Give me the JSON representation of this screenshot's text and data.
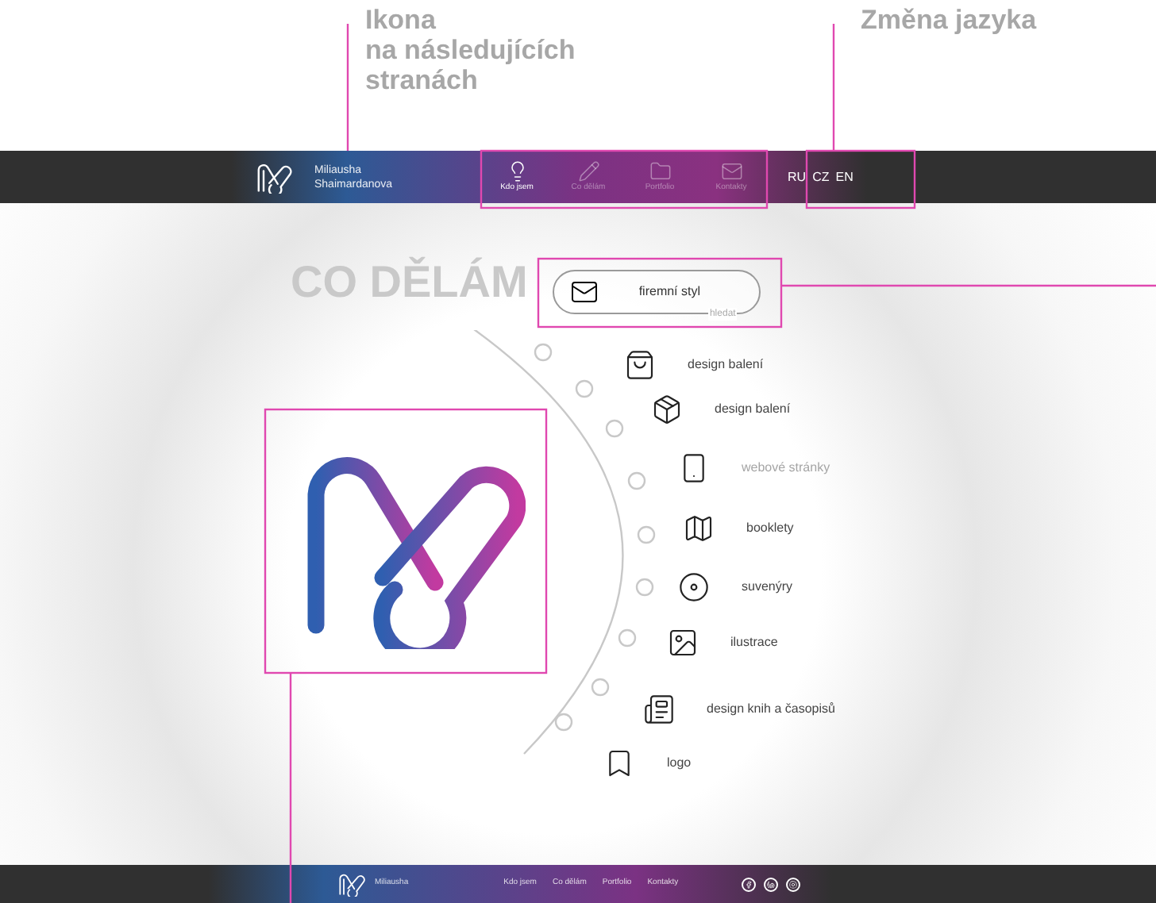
{
  "annotations": [
    {
      "text": "Ikona\nna následujících\nstranách"
    },
    {
      "text": "Změna jazyka"
    }
  ],
  "header": {
    "name": "Miliausha\nShaimardanova",
    "nav": [
      {
        "label": "Kdo jsem",
        "kind": "bulb",
        "selected": true
      },
      {
        "label": "Co dělám",
        "kind": "pencil",
        "selected": false
      },
      {
        "label": "Portfolio",
        "kind": "folder",
        "selected": false
      },
      {
        "label": "Kontakty",
        "kind": "envelope",
        "selected": false
      }
    ],
    "languages": [
      "RU",
      "CZ",
      "EN"
    ]
  },
  "section_title": "CO DĚLÁM",
  "search": {
    "value": "firemní styl",
    "label": "hledat"
  },
  "services": [
    {
      "label": "design balení",
      "kind": "bag",
      "dimmed": false
    },
    {
      "label": "design balení",
      "kind": "box",
      "dimmed": false
    },
    {
      "label": "webové stránky",
      "kind": "phone",
      "dimmed": true
    },
    {
      "label": "booklety",
      "kind": "map",
      "dimmed": false
    },
    {
      "label": "suvenýry",
      "kind": "ring",
      "dimmed": false
    },
    {
      "label": "ilustrace",
      "kind": "picture",
      "dimmed": false
    },
    {
      "label": "design knih a časopisů",
      "kind": "newspaper",
      "dimmed": false
    },
    {
      "label": "logo",
      "kind": "logo",
      "dimmed": false
    }
  ],
  "footer": {
    "name": "Miliausha",
    "links": [
      "Kdo jsem",
      "Co dělám",
      "Portfolio",
      "Kontakty"
    ]
  }
}
